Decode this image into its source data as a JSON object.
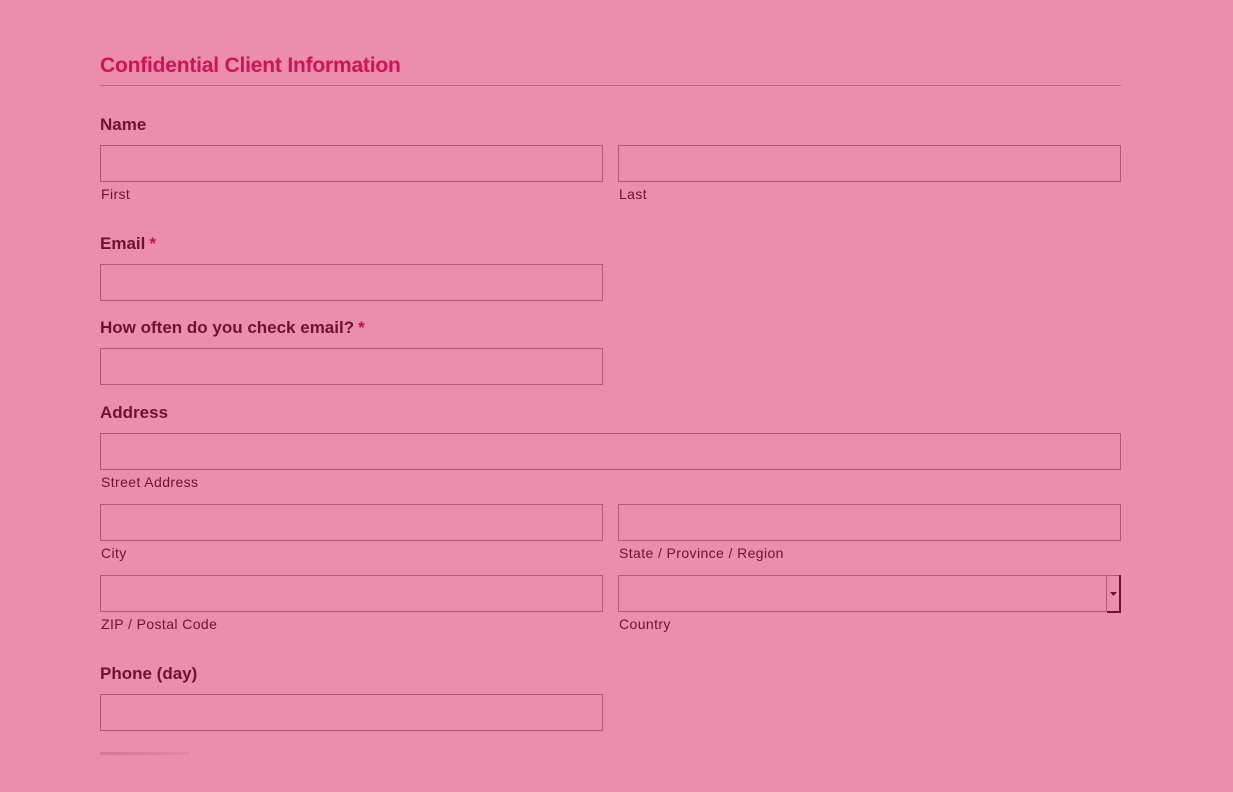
{
  "section": {
    "title": "Confidential Client Information"
  },
  "name": {
    "label": "Name",
    "first_value": "",
    "last_value": "",
    "first_sublabel": "First",
    "last_sublabel": "Last"
  },
  "email": {
    "label": "Email",
    "required_mark": "*",
    "value": ""
  },
  "check_email": {
    "label": "How often do you check email?",
    "required_mark": "*",
    "value": ""
  },
  "address": {
    "label": "Address",
    "street_value": "",
    "street_sublabel": "Street Address",
    "city_value": "",
    "city_sublabel": "City",
    "state_value": "",
    "state_sublabel": "State / Province / Region",
    "zip_value": "",
    "zip_sublabel": "ZIP / Postal Code",
    "country_selected": "",
    "country_sublabel": "Country"
  },
  "phone_day": {
    "label": "Phone (day)",
    "value": ""
  },
  "colors": {
    "background": "#eb8dad",
    "section_title": "#d3124e",
    "label_text": "#6d1230",
    "required_star": "#c3123f",
    "input_border": "#b25778"
  },
  "icons": {
    "select_arrow": "chevron-down-icon"
  }
}
